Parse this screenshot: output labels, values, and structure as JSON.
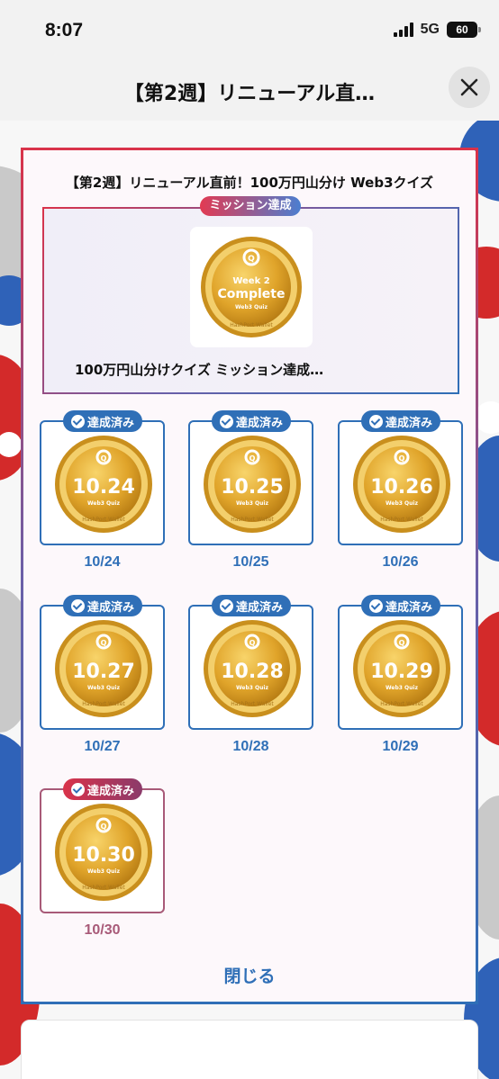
{
  "status": {
    "time": "8:07",
    "network": "5G",
    "battery": "60"
  },
  "header": {
    "title": "【第2週】リニューアル直…"
  },
  "modal": {
    "title": "【第2週】リニューアル直前！100万円山分け Web3クイズ",
    "mission": {
      "tag": "ミッション達成",
      "label": "100万円山分けクイズ ミッション達成…",
      "coin": {
        "line1": "Week 2",
        "line2": "Complete",
        "line3": "Web3 Quiz",
        "mark": "Q",
        "rim": "HashPort Wallet"
      }
    },
    "badges": [
      {
        "tag": "達成済み",
        "coin": "10.24",
        "date": "10/24"
      },
      {
        "tag": "達成済み",
        "coin": "10.25",
        "date": "10/25"
      },
      {
        "tag": "達成済み",
        "coin": "10.26",
        "date": "10/26"
      },
      {
        "tag": "達成済み",
        "coin": "10.27",
        "date": "10/27"
      },
      {
        "tag": "達成済み",
        "coin": "10.28",
        "date": "10/28"
      },
      {
        "tag": "達成済み",
        "coin": "10.29",
        "date": "10/29"
      },
      {
        "tag": "達成済み",
        "coin": "10.30",
        "date": "10/30"
      }
    ],
    "coin_sub": "Web3 Quiz",
    "coin_mark": "Q",
    "coin_rim": "HashPort Wallet",
    "close_label": "閉じる"
  },
  "colors": {
    "accent": "#2f6fb7",
    "red": "#d9334a",
    "gold": "#e2a92e"
  }
}
